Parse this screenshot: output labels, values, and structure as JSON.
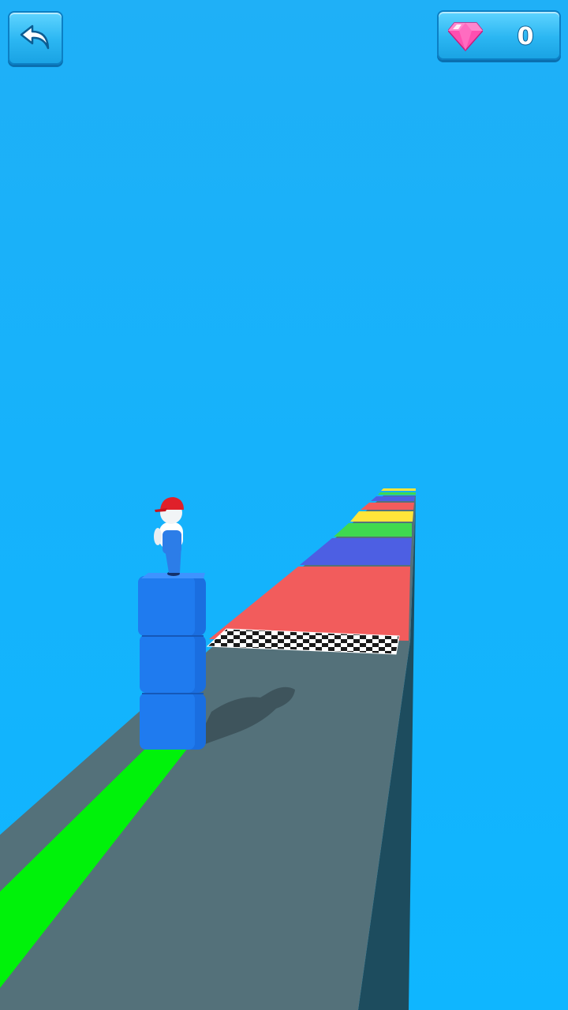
{
  "hud": {
    "back_button_icon": "undo-arrow-icon",
    "gem_icon": "diamond-gem-icon",
    "gem_count": "0"
  },
  "scene": {
    "player": "stickman-with-red-cap",
    "stack_blocks": 3,
    "stack_block_color": "#1a73e8",
    "trail_color": "#00f20a",
    "track_color": "#54717a",
    "finish_line": "checkered-strip",
    "color_bands": [
      "#f25c5c",
      "#4d5fe3",
      "#3fd94f",
      "#ffe53a",
      "#f25c5c",
      "#4d5fe3",
      "#3fd94f",
      "#ffe53a"
    ]
  },
  "colors": {
    "sky": "#16b2fb",
    "hud_button": "#2bb6f2",
    "gem": "#ff4fb0"
  }
}
